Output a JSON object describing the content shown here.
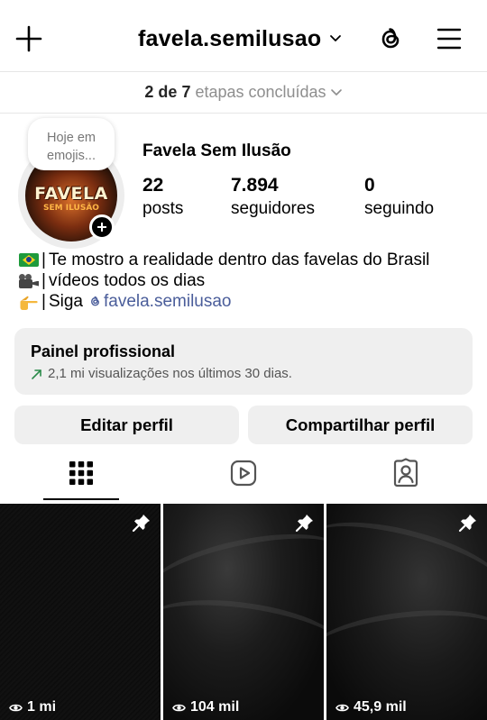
{
  "header": {
    "username": "favela.semilusao",
    "icons": [
      "plus-icon",
      "chevron-down-icon",
      "threads-icon",
      "menu-icon"
    ]
  },
  "steps": {
    "count": "2 de 7",
    "label": "etapas concluídas"
  },
  "profile": {
    "note": "Hoje em emojis...",
    "avatar_text_main": "FAVELA",
    "avatar_text_sub": "SEM ILUSÃO",
    "display_name": "Favela Sem Ilusão",
    "stats": [
      {
        "value": "22",
        "label": "posts"
      },
      {
        "value": "7.894",
        "label": "seguidores"
      },
      {
        "value": "0",
        "label": "seguindo"
      }
    ]
  },
  "bio": {
    "line1": "Te mostro a realidade dentro das favelas do Brasil",
    "line2": "vídeos todos os dias",
    "line3_prefix": "Siga",
    "line3_handle": "favela.semilusao",
    "separator": "|"
  },
  "pro_panel": {
    "title": "Painel profissional",
    "subtitle": "2,1 mi visualizações nos últimos 30 dias."
  },
  "buttons": {
    "edit": "Editar perfil",
    "share": "Compartilhar perfil"
  },
  "tabs": [
    "grid-icon",
    "reels-icon",
    "tagged-icon"
  ],
  "posts": [
    {
      "views": "1 mi",
      "pinned": true
    },
    {
      "views": "104 mil",
      "pinned": true
    },
    {
      "views": "45,9 mil",
      "pinned": true
    }
  ],
  "colors": {
    "link": "#4a5d9a",
    "panel_bg": "#efefef",
    "muted": "#8e8e8e"
  }
}
